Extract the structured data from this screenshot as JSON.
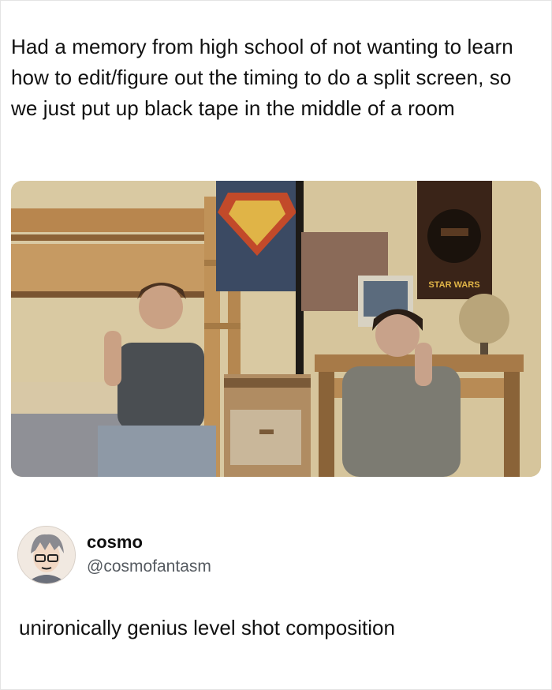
{
  "post": {
    "text": "Had a memory from high school of not wanting to learn how to edit/figure out the timing to do a split screen, so we just put up black tape in the middle of a room"
  },
  "media": {
    "poster_text": "STAR WARS"
  },
  "reply": {
    "display_name": "cosmo",
    "handle": "@cosmofantasm",
    "text": "unironically genius level shot composition"
  }
}
